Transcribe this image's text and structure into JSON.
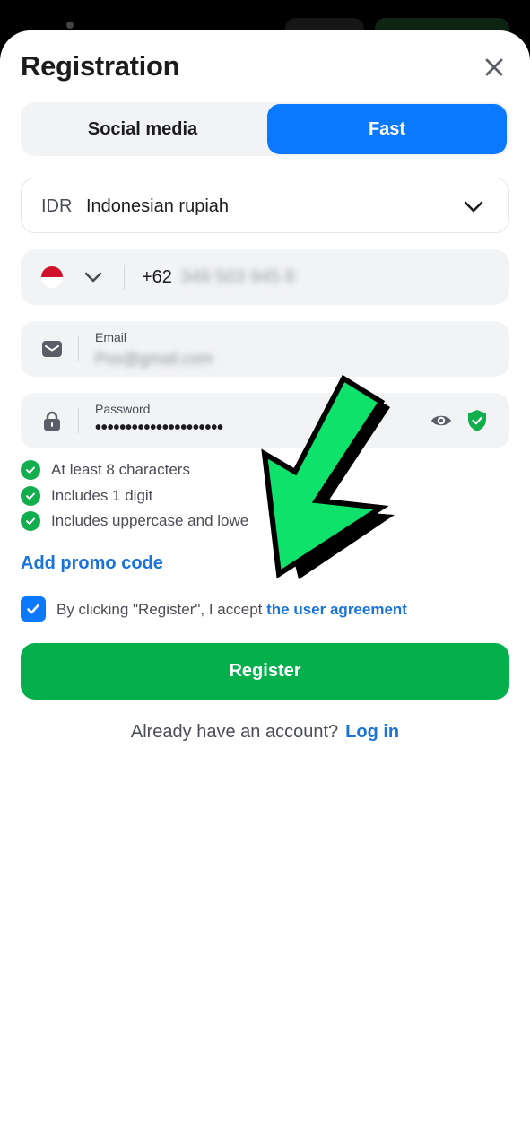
{
  "header": {
    "title": "Registration"
  },
  "tabs": [
    {
      "label": "Social media",
      "selected": false
    },
    {
      "label": "Fast",
      "selected": true
    }
  ],
  "currency": {
    "code": "IDR",
    "name": "Indonesian rupiah"
  },
  "phone": {
    "prefix": "+62",
    "number": "349 503 945 8"
  },
  "email": {
    "label": "Email",
    "value": "Pos@gmail.com"
  },
  "password": {
    "label": "Password",
    "value": "•••••••••••••••••••••"
  },
  "rules": [
    {
      "text": "At least 8 characters"
    },
    {
      "text": "Includes 1 digit"
    },
    {
      "text": "Includes uppercase and lowe"
    }
  ],
  "promo_label": "Add promo code",
  "agreement": {
    "prefix": "By clicking \"Register\", I accept",
    "link": "the user agreement",
    "checked": true
  },
  "register_label": "Register",
  "login": {
    "prompt": "Already have an account?",
    "link": "Log in"
  },
  "colors": {
    "accent": "#0a78ff",
    "register": "#05b04c",
    "link": "#1a73d9",
    "arrow": "#0ee26a"
  }
}
